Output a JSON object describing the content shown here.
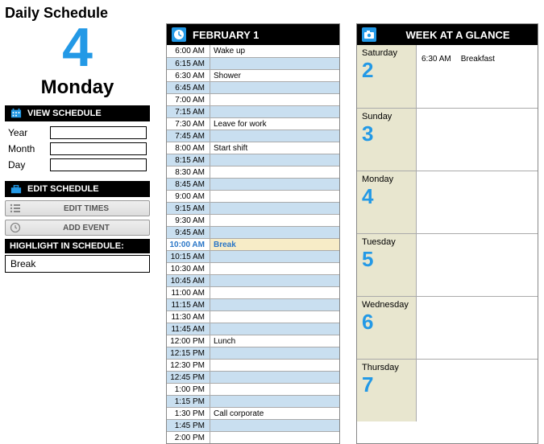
{
  "title": "Daily Schedule",
  "side": {
    "date_number": "4",
    "day_name": "Monday",
    "view_label": "VIEW SCHEDULE",
    "year_label": "Year",
    "month_label": "Month",
    "day_label": "Day",
    "edit_label": "EDIT SCHEDULE",
    "btn_times": "EDIT TIMES",
    "btn_event": "ADD EVENT",
    "highlight_label": "HIGHLIGHT IN SCHEDULE:",
    "highlight_value": "Break"
  },
  "daily": {
    "header": "FEBRUARY 1",
    "rows": [
      {
        "t": "6:00 AM",
        "e": "Wake up",
        "alt": 0,
        "hl": 0
      },
      {
        "t": "6:15 AM",
        "e": "",
        "alt": 1,
        "hl": 0
      },
      {
        "t": "6:30 AM",
        "e": "Shower",
        "alt": 0,
        "hl": 0
      },
      {
        "t": "6:45 AM",
        "e": "",
        "alt": 1,
        "hl": 0
      },
      {
        "t": "7:00 AM",
        "e": "",
        "alt": 0,
        "hl": 0
      },
      {
        "t": "7:15 AM",
        "e": "",
        "alt": 1,
        "hl": 0
      },
      {
        "t": "7:30 AM",
        "e": "Leave for work",
        "alt": 0,
        "hl": 0
      },
      {
        "t": "7:45 AM",
        "e": "",
        "alt": 1,
        "hl": 0
      },
      {
        "t": "8:00 AM",
        "e": "Start shift",
        "alt": 0,
        "hl": 0
      },
      {
        "t": "8:15 AM",
        "e": "",
        "alt": 1,
        "hl": 0
      },
      {
        "t": "8:30 AM",
        "e": "",
        "alt": 0,
        "hl": 0
      },
      {
        "t": "8:45 AM",
        "e": "",
        "alt": 1,
        "hl": 0
      },
      {
        "t": "9:00 AM",
        "e": "",
        "alt": 0,
        "hl": 0
      },
      {
        "t": "9:15 AM",
        "e": "",
        "alt": 1,
        "hl": 0
      },
      {
        "t": "9:30 AM",
        "e": "",
        "alt": 0,
        "hl": 0
      },
      {
        "t": "9:45 AM",
        "e": "",
        "alt": 1,
        "hl": 0
      },
      {
        "t": "10:00 AM",
        "e": "Break",
        "alt": 0,
        "hl": 1
      },
      {
        "t": "10:15 AM",
        "e": "",
        "alt": 1,
        "hl": 0
      },
      {
        "t": "10:30 AM",
        "e": "",
        "alt": 0,
        "hl": 0
      },
      {
        "t": "10:45 AM",
        "e": "",
        "alt": 1,
        "hl": 0
      },
      {
        "t": "11:00 AM",
        "e": "",
        "alt": 0,
        "hl": 0
      },
      {
        "t": "11:15 AM",
        "e": "",
        "alt": 1,
        "hl": 0
      },
      {
        "t": "11:30 AM",
        "e": "",
        "alt": 0,
        "hl": 0
      },
      {
        "t": "11:45 AM",
        "e": "",
        "alt": 1,
        "hl": 0
      },
      {
        "t": "12:00 PM",
        "e": "Lunch",
        "alt": 0,
        "hl": 0
      },
      {
        "t": "12:15 PM",
        "e": "",
        "alt": 1,
        "hl": 0
      },
      {
        "t": "12:30 PM",
        "e": "",
        "alt": 0,
        "hl": 0
      },
      {
        "t": "12:45 PM",
        "e": "",
        "alt": 1,
        "hl": 0
      },
      {
        "t": "1:00 PM",
        "e": "",
        "alt": 0,
        "hl": 0
      },
      {
        "t": "1:15 PM",
        "e": "",
        "alt": 1,
        "hl": 0
      },
      {
        "t": "1:30 PM",
        "e": "Call corporate",
        "alt": 0,
        "hl": 0
      },
      {
        "t": "1:45 PM",
        "e": "",
        "alt": 1,
        "hl": 0
      },
      {
        "t": "2:00 PM",
        "e": "",
        "alt": 0,
        "hl": 0
      }
    ]
  },
  "week": {
    "header": "WEEK AT A GLANCE",
    "days": [
      {
        "name": "Saturday",
        "num": "2",
        "events": [
          {
            "t": "6:30 AM",
            "e": "Breakfast"
          }
        ]
      },
      {
        "name": "Sunday",
        "num": "3",
        "events": []
      },
      {
        "name": "Monday",
        "num": "4",
        "events": []
      },
      {
        "name": "Tuesday",
        "num": "5",
        "events": []
      },
      {
        "name": "Wednesday",
        "num": "6",
        "events": []
      },
      {
        "name": "Thursday",
        "num": "7",
        "events": []
      }
    ]
  }
}
